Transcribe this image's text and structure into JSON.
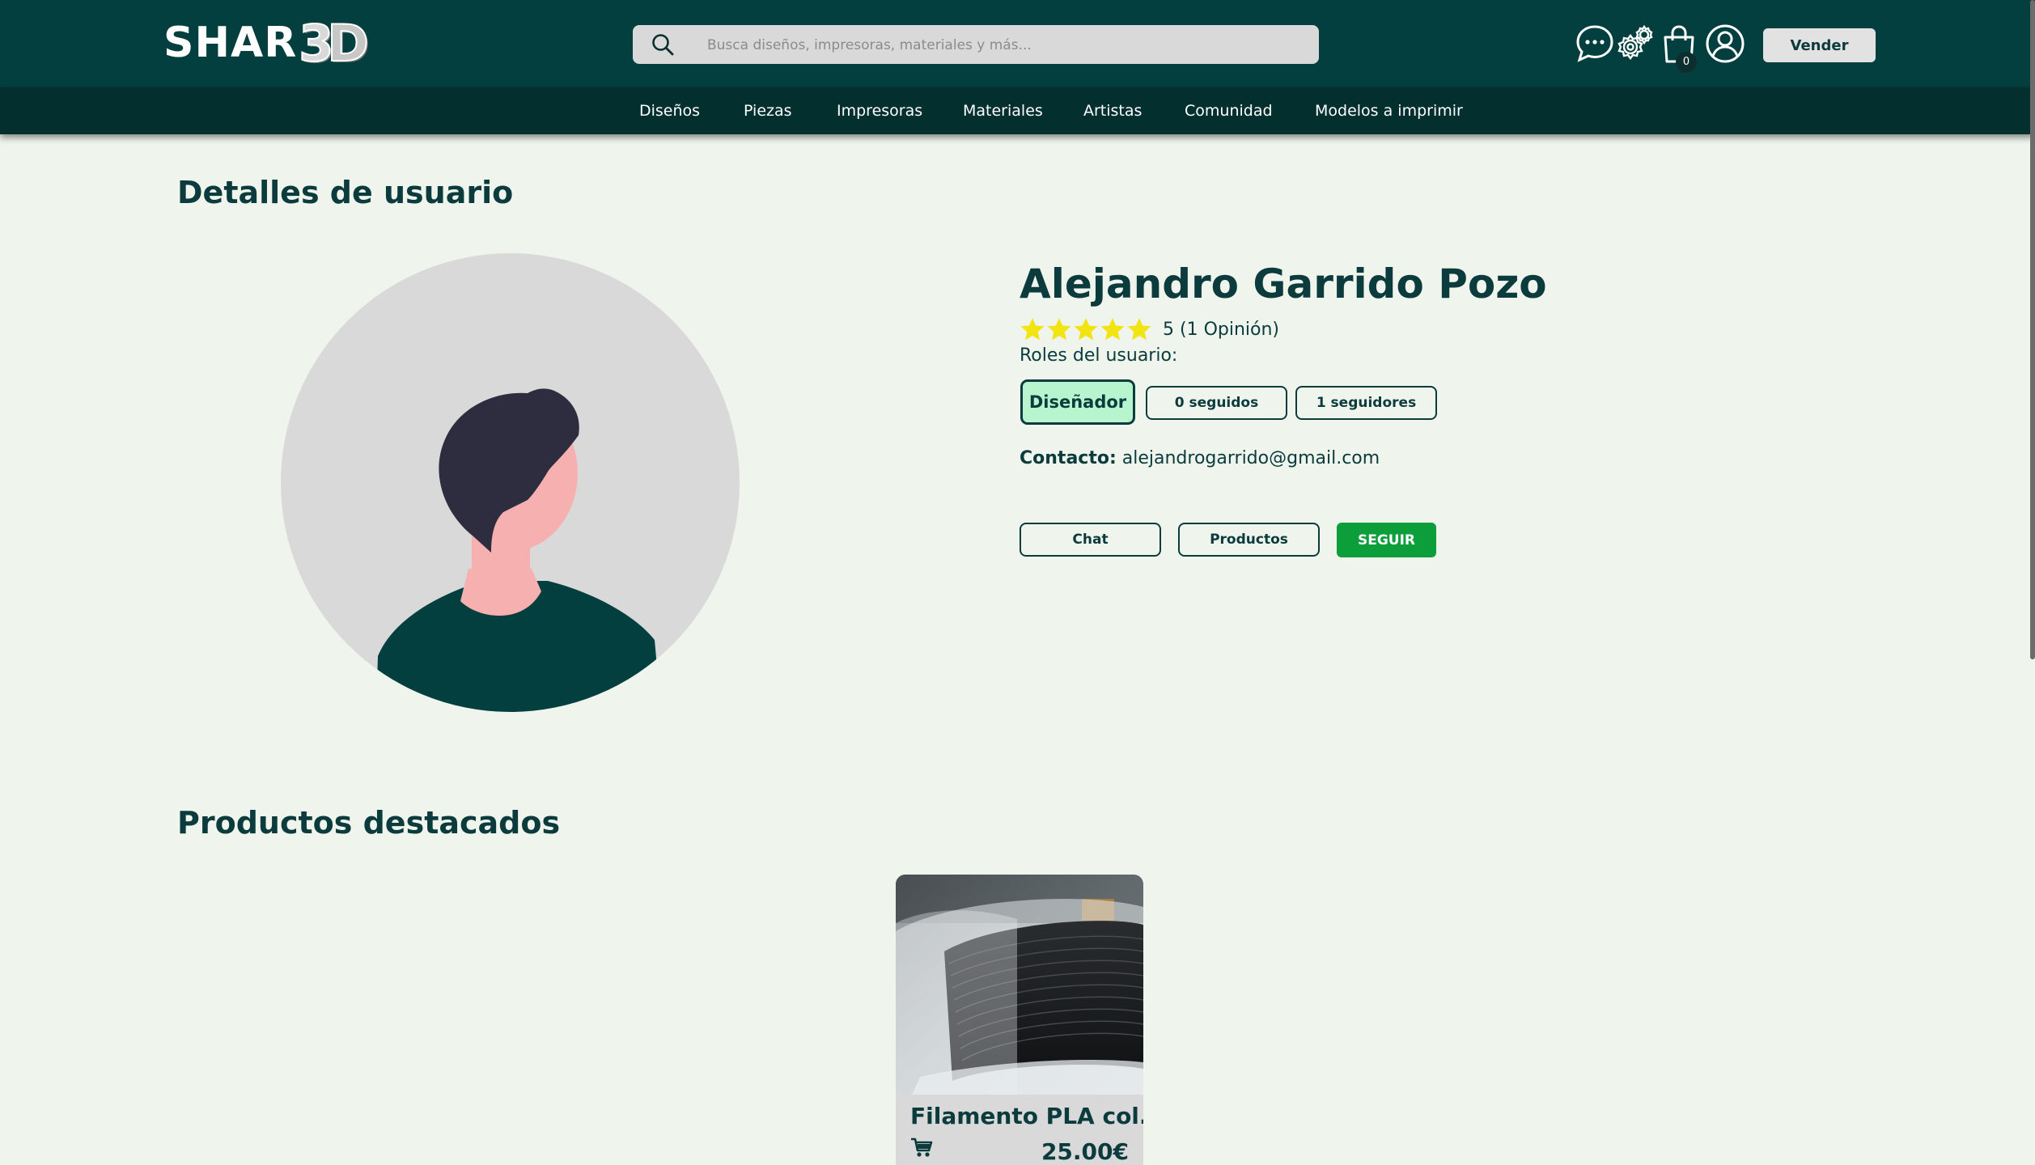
{
  "header": {
    "logo": {
      "text": "SHAR",
      "three": "3",
      "d": "D"
    },
    "search_placeholder": "Busca diseños, impresoras, materiales y más...",
    "cart_count": "0",
    "sell_label": "Vender"
  },
  "nav": {
    "items": [
      "Diseños",
      "Piezas",
      "Impresoras",
      "Materiales",
      "Artistas",
      "Comunidad",
      "Modelos a imprimir"
    ]
  },
  "profile": {
    "section_title": "Detalles de usuario",
    "name": "Alejandro Garrido Pozo",
    "rating_value": 5,
    "rating_text": "5 (1 Opinión)",
    "roles_label": "Roles del usuario:",
    "role": "Diseñador",
    "following": "0 seguidos",
    "followers": "1 seguidores",
    "contact_label": "Contacto:",
    "contact_email": "alejandrogarrido@gmail.com",
    "chat_label": "Chat",
    "products_label": "Productos",
    "follow_label": "SEGUIR"
  },
  "featured": {
    "section_title": "Productos destacados",
    "products": [
      {
        "title": "Filamento PLA col...",
        "price": "25.00€"
      }
    ]
  },
  "colors": {
    "brand_dark": "#043f3f",
    "nav_dark": "#032f2f",
    "page_bg": "#eff5ed",
    "accent_green": "#0c9e3a",
    "role_bg": "#b7f5cf",
    "star": "#f2e413"
  },
  "icons": [
    "search-icon",
    "chat-icon",
    "settings-icon",
    "shopping-bag-icon",
    "user-icon",
    "star-icon",
    "cart-icon"
  ]
}
